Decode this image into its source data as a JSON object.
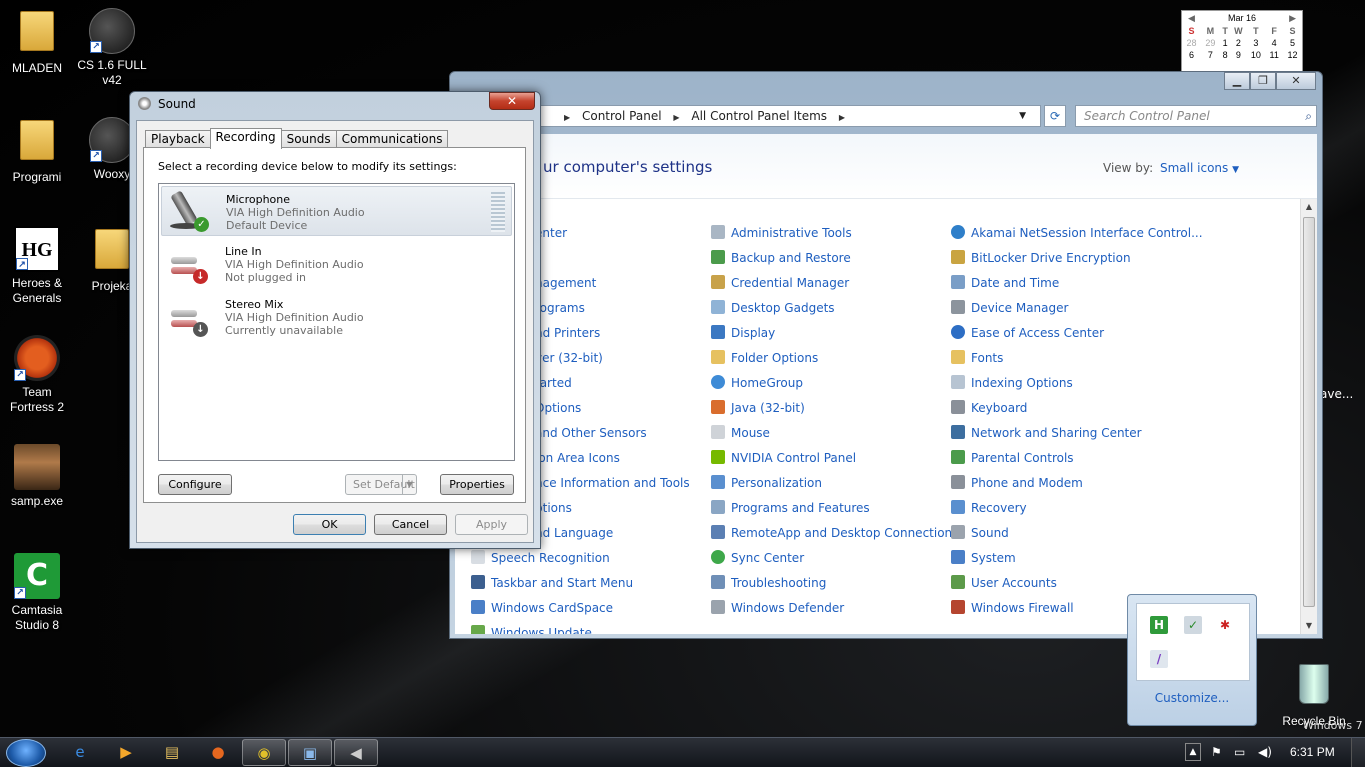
{
  "desktop": {
    "icons": [
      {
        "label": "MLADEN"
      },
      {
        "label": "CS 1.6 FULL v42"
      },
      {
        "label": "Programi"
      },
      {
        "label": "Wooxy"
      },
      {
        "label": "Heroes & Generals"
      },
      {
        "label": "Projeka"
      },
      {
        "label": "Team Fortress 2"
      },
      {
        "label": "samp.exe"
      },
      {
        "label": "Camtasia Studio 8"
      },
      {
        "label": "Recycle Bin"
      }
    ],
    "partial_right_label": "ave...",
    "watermark": "Windows 7"
  },
  "calendar": {
    "month": "Mar 16",
    "days": [
      "S",
      "M",
      "T",
      "W",
      "T",
      "F",
      "S"
    ],
    "rows": [
      [
        "28",
        "29",
        "1",
        "2",
        "3",
        "4",
        "5"
      ],
      [
        "6",
        "7",
        "8",
        "9",
        "10",
        "11",
        "12"
      ]
    ]
  },
  "control_panel": {
    "breadcrumb": [
      "Control Panel",
      "All Control Panel Items"
    ],
    "search_placeholder": "Search Control Panel",
    "title": "ur computer's settings",
    "view_by_label": "View by:",
    "view_by_value": "Small icons",
    "col1": [
      "enter",
      "",
      "nagement",
      "rograms",
      "nd Printers",
      "ver (32-bit)",
      "tarted",
      "Options",
      "and Other Sensors",
      "ion Area Icons",
      "nce Information and Tools",
      "ptions",
      "nd Language",
      "Speech Recognition",
      "Taskbar and Start Menu",
      "Windows CardSpace",
      "Windows Update"
    ],
    "col2": [
      "Administrative Tools",
      "Backup and Restore",
      "Credential Manager",
      "Desktop Gadgets",
      "Display",
      "Folder Options",
      "HomeGroup",
      "Java (32-bit)",
      "Mouse",
      "NVIDIA Control Panel",
      "Personalization",
      "Programs and Features",
      "RemoteApp and Desktop Connections",
      "Sync Center",
      "Troubleshooting",
      "Windows Defender"
    ],
    "col3": [
      "Akamai NetSession Interface Control...",
      "BitLocker Drive Encryption",
      "Date and Time",
      "Device Manager",
      "Ease of Access Center",
      "Fonts",
      "Indexing Options",
      "Keyboard",
      "Network and Sharing Center",
      "Parental Controls",
      "Phone and Modem",
      "Recovery",
      "Sound",
      "System",
      "User Accounts",
      "Windows Firewall"
    ]
  },
  "sound_dialog": {
    "title": "Sound",
    "tabs": [
      "Playback",
      "Recording",
      "Sounds",
      "Communications"
    ],
    "active_tab": "Recording",
    "instruction": "Select a recording device below to modify its settings:",
    "devices": [
      {
        "name": "Microphone",
        "driver": "VIA High Definition Audio",
        "status": "Default Device"
      },
      {
        "name": "Line In",
        "driver": "VIA High Definition Audio",
        "status": "Not plugged in"
      },
      {
        "name": "Stereo Mix",
        "driver": "VIA High Definition Audio",
        "status": "Currently unavailable"
      }
    ],
    "buttons": {
      "configure": "Configure",
      "set_default": "Set Default",
      "properties": "Properties",
      "ok": "OK",
      "cancel": "Cancel",
      "apply": "Apply"
    }
  },
  "tray_popup": {
    "customize": "Customize..."
  },
  "taskbar": {
    "clock": "6:31 PM"
  }
}
